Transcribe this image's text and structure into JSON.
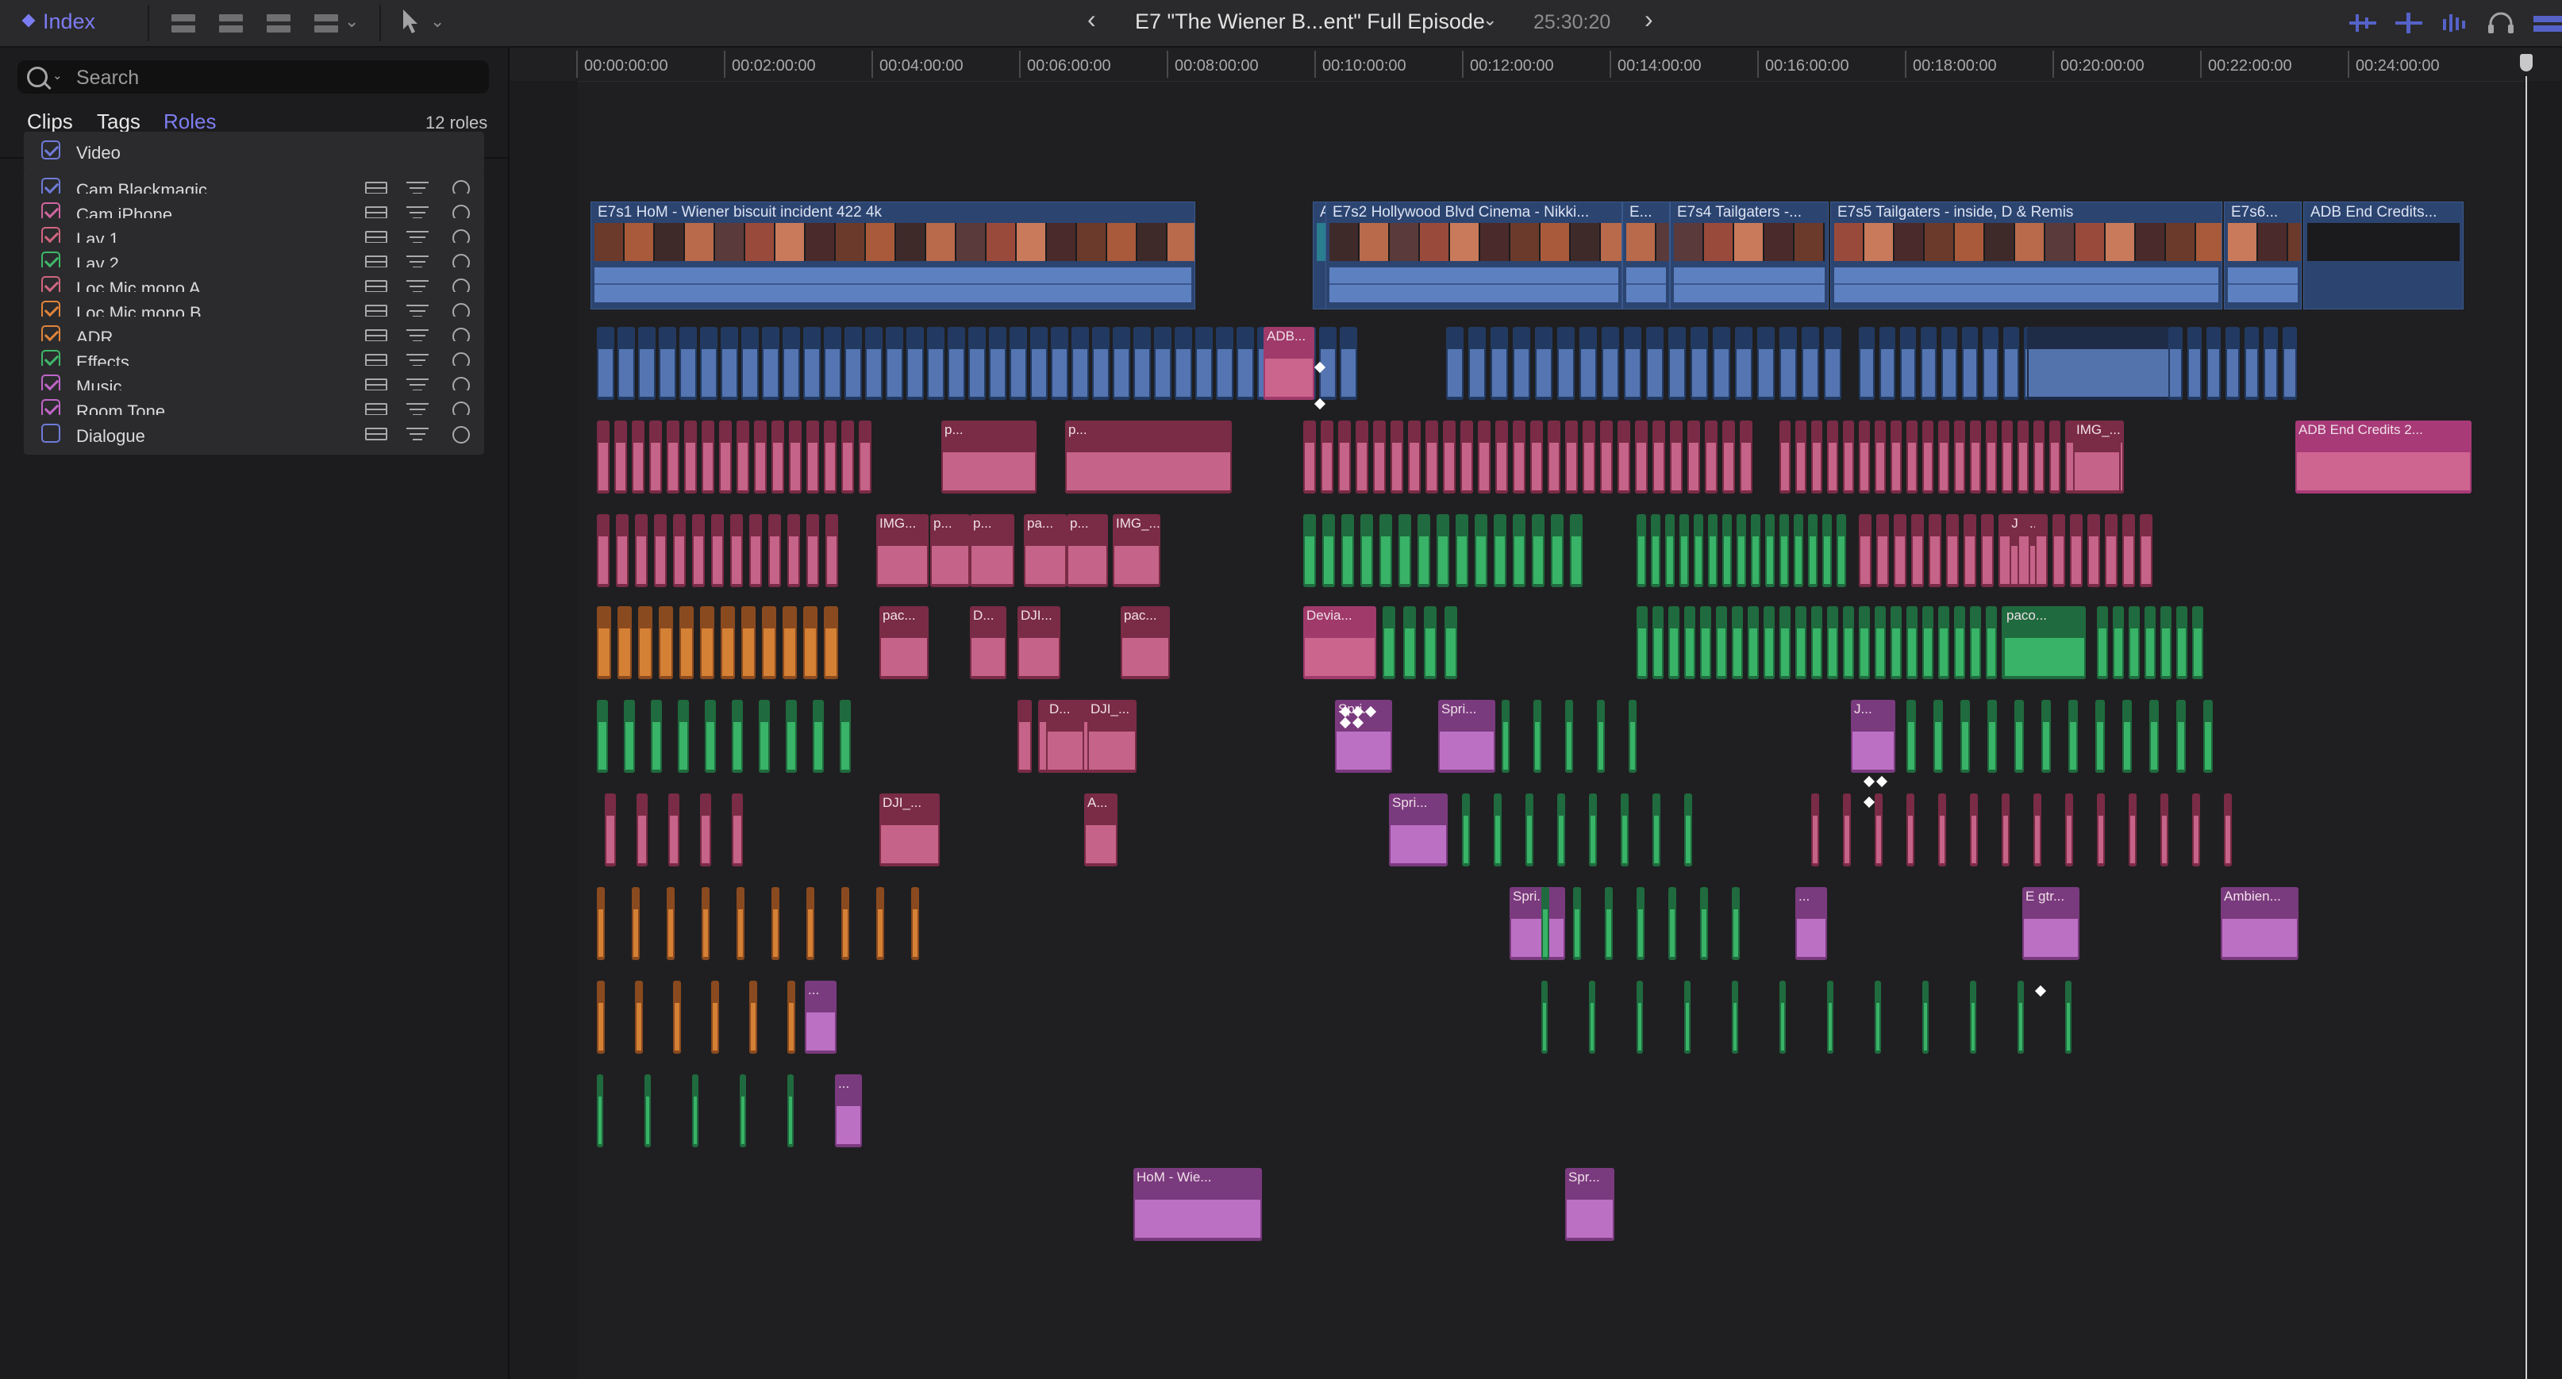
{
  "toolbar": {
    "index_label": "Index",
    "project_title": "E7 \"The Wiener B...ent\" Full Episode",
    "duration": "25:30:20"
  },
  "sidebar": {
    "search_placeholder": "Search",
    "tabs": [
      {
        "label": "Clips",
        "active": false
      },
      {
        "label": "Tags",
        "active": false
      },
      {
        "label": "Roles",
        "active": true
      }
    ],
    "roles_count": "12 roles",
    "roles": [
      {
        "label": "Video",
        "checked": true,
        "color": "#6f7bd8",
        "kind": "video"
      },
      {
        "label": "Cam Blackmagic",
        "checked": true,
        "color": "#6f7bd8",
        "kind": "audio"
      },
      {
        "label": "Cam iPhone",
        "checked": true,
        "color": "#d066a0",
        "kind": "audio"
      },
      {
        "label": "Lav 1",
        "checked": true,
        "color": "#d06680",
        "kind": "audio"
      },
      {
        "label": "Lav 2",
        "checked": true,
        "color": "#3fb86a",
        "kind": "audio"
      },
      {
        "label": "Loc Mic mono A",
        "checked": true,
        "color": "#d06680",
        "kind": "audio"
      },
      {
        "label": "Loc Mic mono B",
        "checked": true,
        "color": "#e0843a",
        "kind": "audio"
      },
      {
        "label": "ADR",
        "checked": true,
        "color": "#e0843a",
        "kind": "audio"
      },
      {
        "label": "Effects",
        "checked": true,
        "color": "#3fb86a",
        "kind": "audio"
      },
      {
        "label": "Music",
        "checked": true,
        "color": "#c066c8",
        "kind": "audio"
      },
      {
        "label": "Room Tone",
        "checked": true,
        "color": "#c066c8",
        "kind": "audio"
      },
      {
        "label": "Dialogue",
        "checked": false,
        "color": "#6f7bd8",
        "kind": "audio"
      }
    ]
  },
  "timeline": {
    "ruler": [
      "00:00:00:00",
      "00:02:00:00",
      "00:04:00:00",
      "00:06:00:00",
      "00:08:00:00",
      "00:10:00:00",
      "00:12:00:00",
      "00:14:00:00",
      "00:16:00:00",
      "00:18:00:00",
      "00:20:00:00",
      "00:22:00:00",
      "00:24:00:00"
    ],
    "primary_clips": [
      {
        "name": "E7s1 HoM - Wiener biscuit incident 422 4k"
      },
      {
        "name": "ADB..."
      },
      {
        "name": "E7s2 Hollywood Blvd Cinema - Nikki..."
      },
      {
        "name": "E..."
      },
      {
        "name": "E7s4 Tailgaters -..."
      },
      {
        "name": "E7s5 Tailgaters -  inside, D & Remis"
      },
      {
        "name": "E7s6..."
      },
      {
        "name": "ADB End Credits..."
      }
    ],
    "connected_labels": {
      "adb_top": "ADB...",
      "adb_end": "ADB End Credits 2...",
      "img1": "IMG...",
      "img2": "IMG_...",
      "img3": "IMG_...",
      "dji1": "DJI_...",
      "dji2": "DJI...",
      "dji3": "DJI_...",
      "dji4": "DJI_...",
      "pac1": "pac...",
      "pac2": "pac...",
      "paco": "paco...",
      "devia": "Devia...",
      "spri1": "Spri...",
      "spri2": "Spri...",
      "spri3": "Spri...",
      "spri4": "Spri...",
      "spri5": "Spr...",
      "egtr": "E gtr...",
      "ambien": "Ambien...",
      "hom": "HoM - Wie...",
      "pa": "pa...",
      "p1": "p...",
      "p2": "p...",
      "p3": "p...",
      "a1": "A...",
      "d1": "D...",
      "d2": "D...",
      "j1": "J...",
      "dots": "..."
    }
  }
}
